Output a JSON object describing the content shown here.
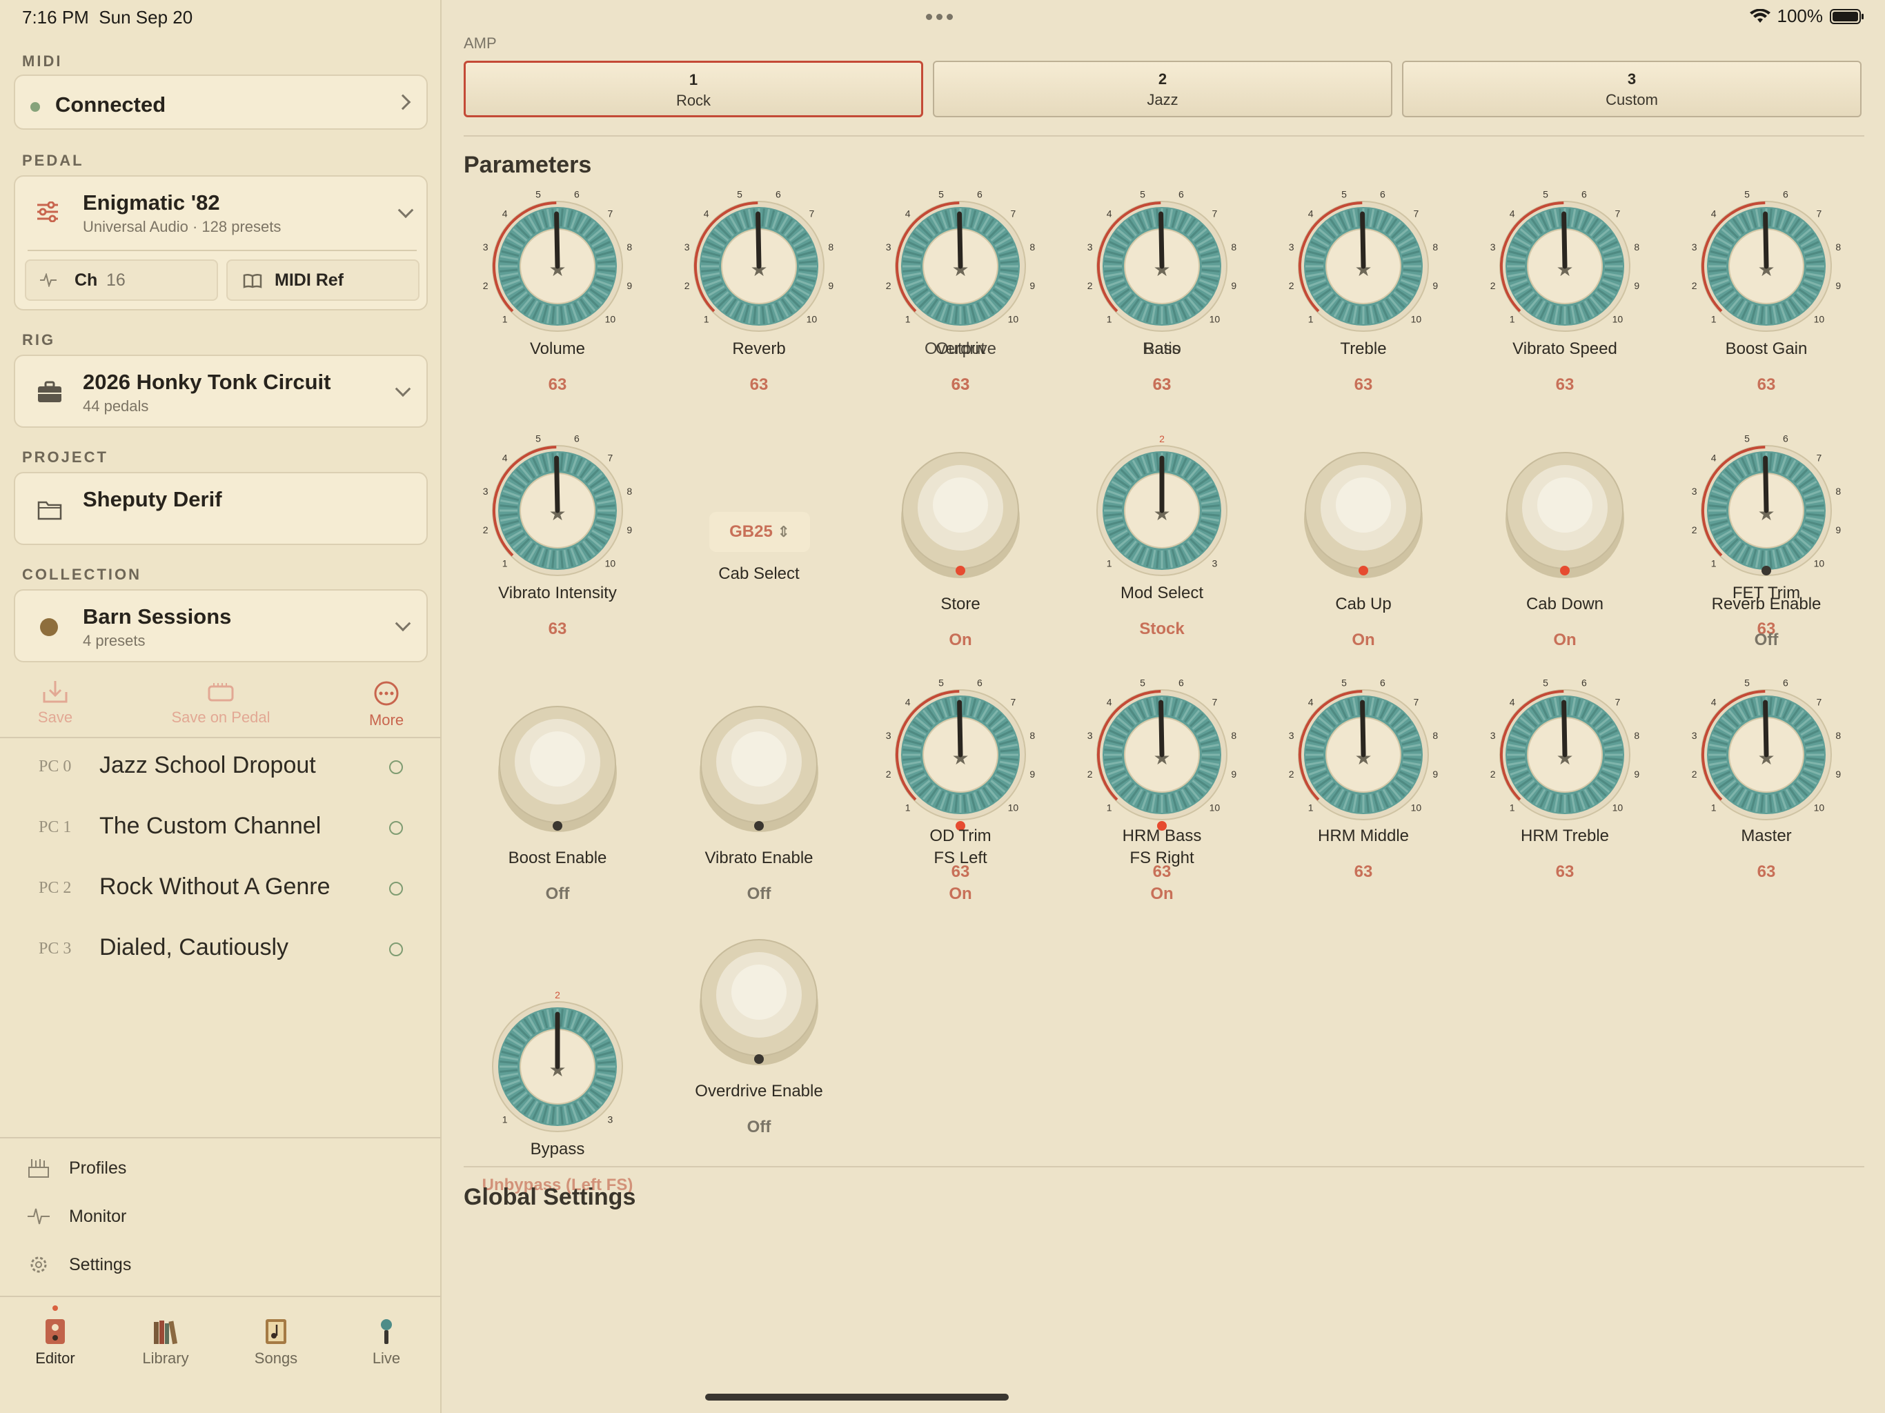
{
  "status_bar": {
    "time": "7:16 PM",
    "date": "Sun Sep 20",
    "battery": "100%"
  },
  "sidebar": {
    "midi": {
      "label": "MIDI",
      "status": "Connected"
    },
    "pedal": {
      "label": "PEDAL",
      "name": "Enigmatic '82",
      "sub": "Universal Audio · 128 presets",
      "ch_label": "Ch",
      "ch_value": "16",
      "midi_ref": "MIDI Ref"
    },
    "rig": {
      "label": "RIG",
      "name": "2026 Honky Tonk Circuit",
      "sub": "44 pedals"
    },
    "project": {
      "label": "PROJECT",
      "name": "Sheputy Derif"
    },
    "collection": {
      "label": "COLLECTION",
      "name": "Barn Sessions",
      "sub": "4 presets"
    },
    "toolbar": {
      "save": "Save",
      "save_on_pedal": "Save on Pedal",
      "more": "More"
    },
    "presets": [
      {
        "pc": "PC 0",
        "name": "Jazz School Dropout"
      },
      {
        "pc": "PC 1",
        "name": "The Custom Channel"
      },
      {
        "pc": "PC 2",
        "name": "Rock Without A Genre"
      },
      {
        "pc": "PC 3",
        "name": "Dialed, Cautiously"
      }
    ],
    "nav": {
      "profiles": "Profiles",
      "monitor": "Monitor",
      "settings": "Settings"
    },
    "tabs": {
      "editor": "Editor",
      "library": "Library",
      "songs": "Songs",
      "live": "Live"
    }
  },
  "main": {
    "amp_label": "AMP",
    "amps": [
      {
        "num": "1",
        "name": "Rock"
      },
      {
        "num": "2",
        "name": "Jazz"
      },
      {
        "num": "3",
        "name": "Custom"
      }
    ],
    "parameters_title": "Parameters",
    "global_title": "Global Settings",
    "params": {
      "volume": {
        "name": "Volume",
        "value": "63",
        "level": 63
      },
      "reverb": {
        "name": "Reverb",
        "value": "63",
        "level": 63
      },
      "overdrive": {
        "name": "Overdrive",
        "value": "63",
        "level": 63
      },
      "output": {
        "name": "Output",
        "value": "63"
      },
      "bass": {
        "name": "Bass",
        "value": "63",
        "level": 63
      },
      "ratio": {
        "name": "Ratio",
        "value": "63"
      },
      "treble": {
        "name": "Treble",
        "value": "63",
        "level": 63
      },
      "vibrato_speed": {
        "name": "Vibrato Speed",
        "value": "63",
        "level": 63
      },
      "boost_gain": {
        "name": "Boost Gain",
        "value": "63",
        "level": 63
      },
      "vibrato_intensity": {
        "name": "Vibrato Intensity",
        "value": "63",
        "level": 63
      },
      "cab_select": {
        "name": "Cab Select",
        "value": "GB25"
      },
      "store": {
        "name": "Store",
        "value": "On"
      },
      "mod_select": {
        "name": "Mod Select",
        "value": "Stock",
        "marker": "2"
      },
      "cab_up": {
        "name": "Cab Up",
        "value": "On"
      },
      "cab_down": {
        "name": "Cab Down",
        "value": "On"
      },
      "fet_trim": {
        "name": "FET Trim",
        "value": "63",
        "level": 63
      },
      "reverb_enable": {
        "name": "Reverb Enable",
        "value": "Off"
      },
      "boost_enable": {
        "name": "Boost Enable",
        "value": "Off"
      },
      "vibrato_enable": {
        "name": "Vibrato Enable",
        "value": "Off"
      },
      "od_trim": {
        "name": "OD Trim",
        "value": "63",
        "level": 63
      },
      "fs_left": {
        "name": "FS Left",
        "value": "On"
      },
      "hrm_bass": {
        "name": "HRM Bass",
        "value": "63",
        "level": 63
      },
      "fs_right": {
        "name": "FS Right",
        "value": "On"
      },
      "hrm_middle": {
        "name": "HRM Middle",
        "value": "63",
        "level": 63
      },
      "hrm_treble": {
        "name": "HRM Treble",
        "value": "63",
        "level": 63
      },
      "master": {
        "name": "Master",
        "value": "63",
        "level": 63
      },
      "bypass": {
        "name": "Bypass",
        "value": "Unbypass (Left FS)",
        "marker": "2"
      },
      "overdrive_enable": {
        "name": "Overdrive Enable",
        "value": "Off"
      }
    },
    "dial_ticks": [
      "1",
      "2",
      "3",
      "4",
      "5",
      "6",
      "7",
      "8",
      "9",
      "10"
    ],
    "three_ticks": [
      "1",
      "3"
    ]
  },
  "colors": {
    "accent": "#c44a36",
    "knob_teal": "#5f9e96",
    "value_text": "#c87058",
    "connected_green": "#7f9c72"
  }
}
